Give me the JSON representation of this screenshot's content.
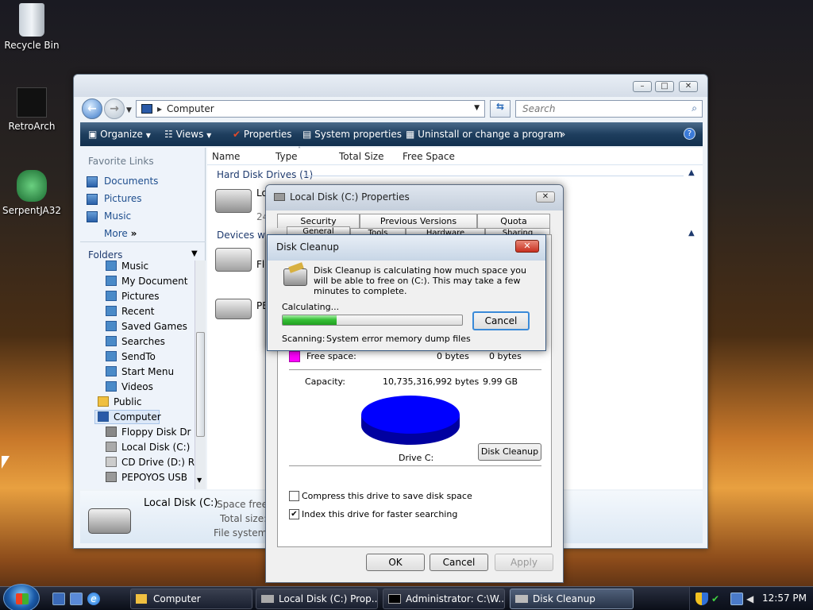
{
  "desktop": {
    "icons": [
      {
        "label": "Recycle Bin"
      },
      {
        "label": "RetroArch"
      },
      {
        "label": "SerpentJA32"
      }
    ]
  },
  "explorer": {
    "address": "Computer",
    "search_placeholder": "Search",
    "toolbar": {
      "organize": "Organize",
      "views": "Views",
      "properties": "Properties",
      "system_properties": "System properties",
      "uninstall": "Uninstall or change a program",
      "more": "»"
    },
    "nav": {
      "favorite_links_header": "Favorite Links",
      "links": [
        "Documents",
        "Pictures",
        "Music"
      ],
      "more": "More",
      "folders_header": "Folders",
      "tree": [
        "Music",
        "My Document",
        "Pictures",
        "Recent",
        "Saved Games",
        "Searches",
        "SendTo",
        "Start Menu",
        "Videos",
        "Public",
        "Computer",
        "Floppy Disk Dr",
        "Local Disk (C:)",
        "CD Drive (D:) R",
        "PEPOYOS USB"
      ]
    },
    "columns": [
      "Name",
      "Type",
      "Total Size",
      "Free Space"
    ],
    "groups": {
      "hdd": "Hard Disk Drives (1)",
      "removable": "Devices with",
      "hdd_item": "Lo",
      "hdd_item_sub": "24",
      "floppy_item": "Flo",
      "usb_item": "PE"
    },
    "details": {
      "name": "Local Disk (C:)",
      "space_free_label": "Space free:",
      "total_size_label": "Total size:",
      "file_system_label": "File system:"
    }
  },
  "properties": {
    "title": "Local Disk (C:) Properties",
    "tabs_top": [
      "Security",
      "Previous Versions",
      "Quota"
    ],
    "tabs_bottom": [
      "General",
      "Tools",
      "Hardware",
      "Sharing"
    ],
    "free_space_label": "Free space:",
    "free_bytes": "0 bytes",
    "free_size": "0 bytes",
    "capacity_label": "Capacity:",
    "capacity_bytes": "10,735,316,992 bytes",
    "capacity_size": "9.99 GB",
    "drive_label": "Drive C:",
    "disk_cleanup_btn": "Disk Cleanup",
    "compress_label": "Compress this drive to save disk space",
    "index_label": "Index this drive for faster searching",
    "compress_checked": false,
    "index_checked": true,
    "ok": "OK",
    "cancel": "Cancel",
    "apply": "Apply",
    "free_color": "#ff00ff",
    "used_color": "#0000ff"
  },
  "cleanup": {
    "title": "Disk Cleanup",
    "message": "Disk Cleanup is calculating how much space you will be able to free on  (C:). This may take a few minutes to complete.",
    "status": "Calculating...",
    "progress": 0.3,
    "cancel": "Cancel",
    "scanning_label": "Scanning:",
    "scanning_item": "System error memory dump files"
  },
  "taskbar": {
    "tasks": [
      "Computer",
      "Local Disk (C:) Prop...",
      "Administrator: C:\\W...",
      "Disk Cleanup"
    ],
    "clock": "12:57 PM"
  }
}
